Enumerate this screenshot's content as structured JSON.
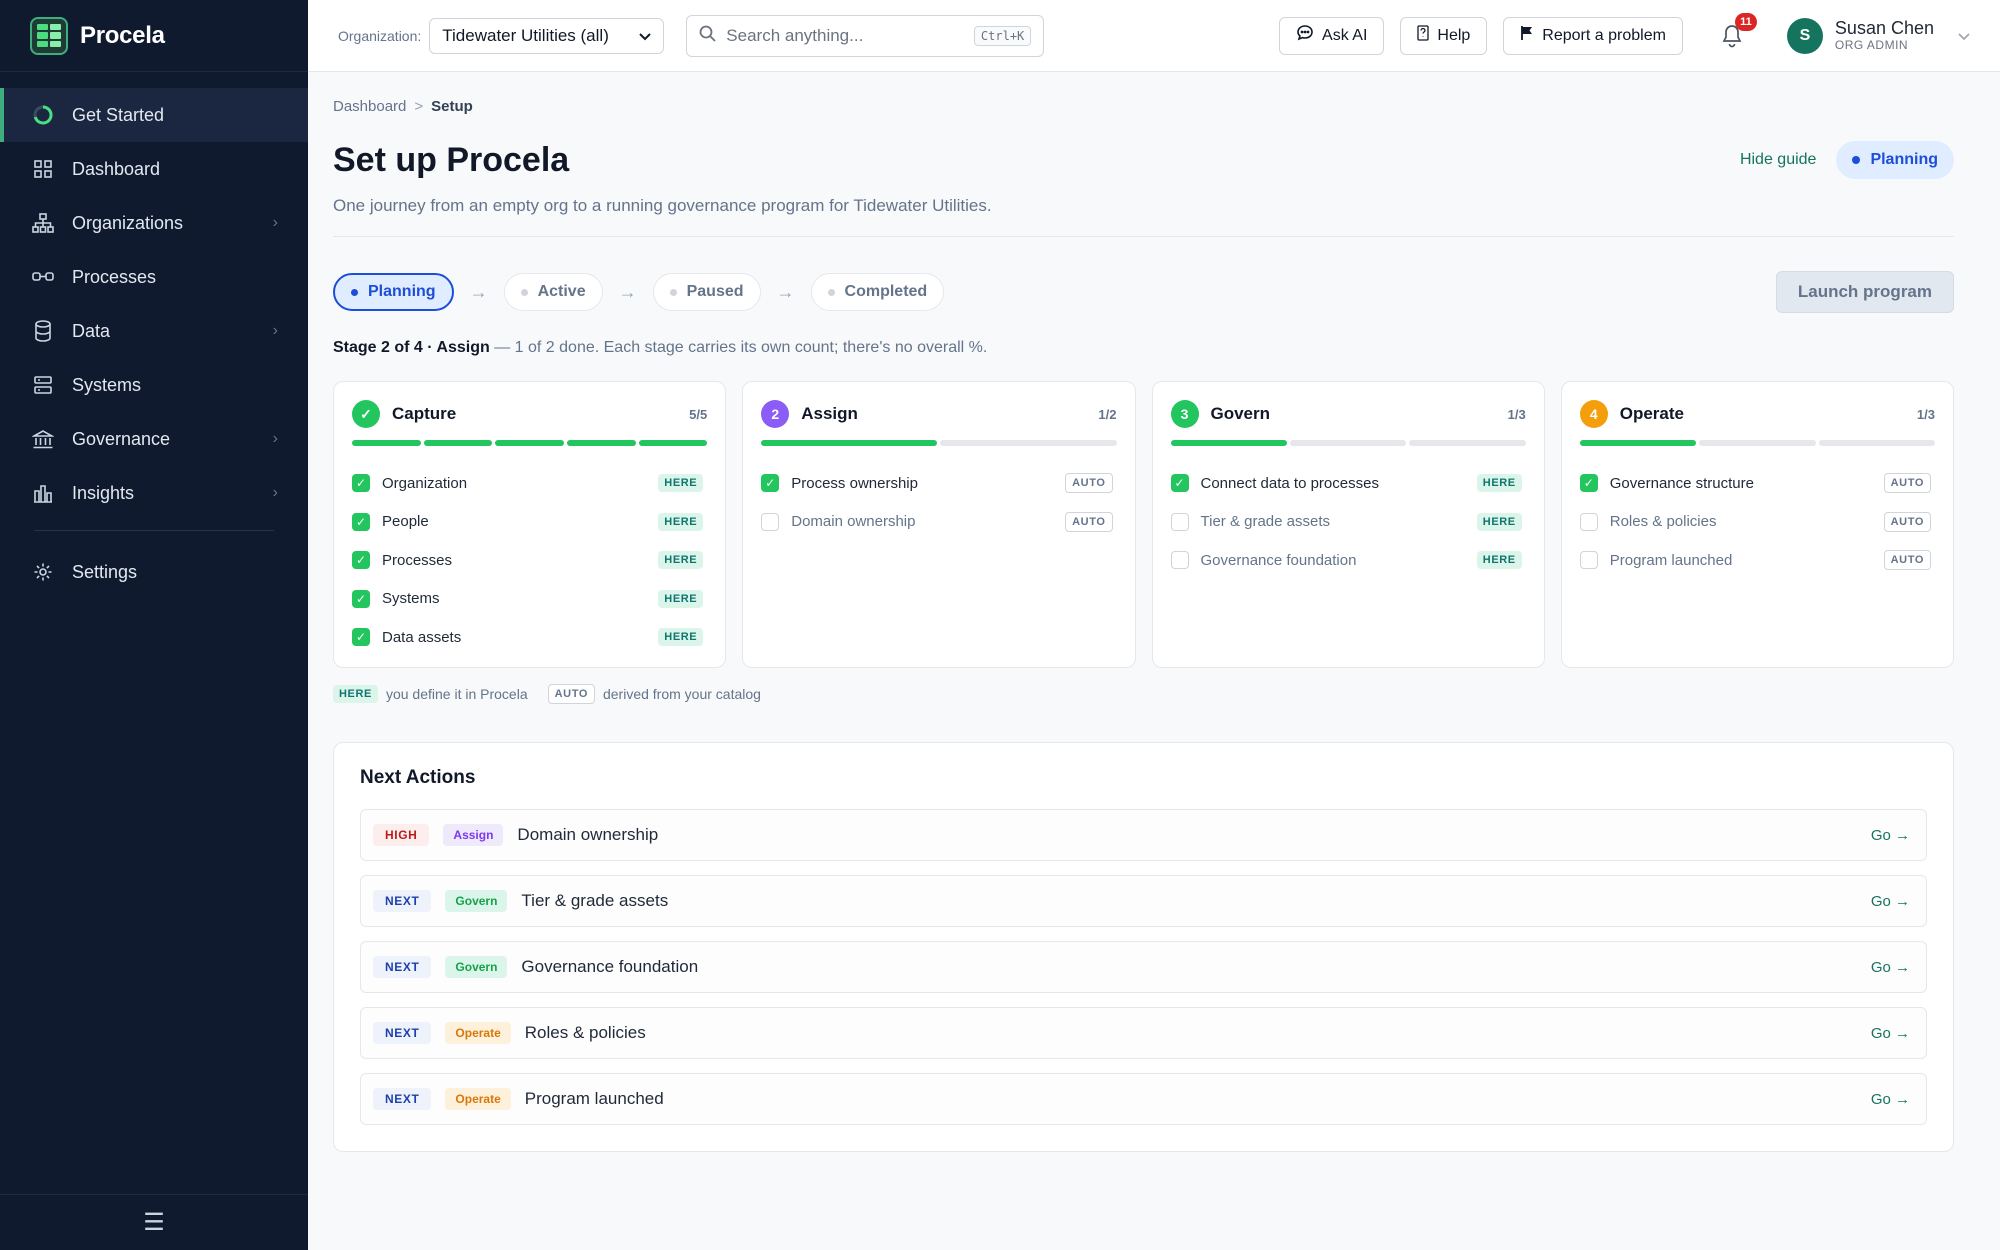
{
  "brand": {
    "name": "Procela"
  },
  "sidebar": {
    "items": [
      {
        "label": "Get Started",
        "icon": "progress-ring-icon",
        "active": true,
        "chevron": false
      },
      {
        "label": "Dashboard",
        "icon": "grid-icon",
        "chevron": false
      },
      {
        "label": "Organizations",
        "icon": "org-chart-icon",
        "chevron": true
      },
      {
        "label": "Processes",
        "icon": "process-link-icon",
        "chevron": false
      },
      {
        "label": "Data",
        "icon": "database-icon",
        "chevron": true
      },
      {
        "label": "Systems",
        "icon": "server-icon",
        "chevron": false
      },
      {
        "label": "Governance",
        "icon": "bank-icon",
        "chevron": true
      },
      {
        "label": "Insights",
        "icon": "bar-chart-icon",
        "chevron": true
      }
    ],
    "settings_label": "Settings",
    "menu_glyph": "☰",
    "chevron_glyph": "›"
  },
  "topbar": {
    "org_label": "Organization:",
    "org_value": "Tidewater Utilities (all)",
    "search_placeholder": "Search anything...",
    "search_shortcut": "Ctrl+K",
    "ask_ai": "Ask AI",
    "help": "Help",
    "report": "Report a problem",
    "notification_count": "11",
    "user_initial": "S",
    "user_name": "Susan Chen",
    "user_role": "ORG ADMIN"
  },
  "breadcrumb": {
    "root": "Dashboard",
    "sep": ">",
    "current": "Setup"
  },
  "page": {
    "title": "Set up Procela",
    "subtitle": "One journey from an empty org to a running governance program for Tidewater Utilities.",
    "hide_guide": "Hide guide",
    "status": "Planning"
  },
  "lifecycle": {
    "stages": [
      "Planning",
      "Active",
      "Paused",
      "Completed"
    ],
    "current": 0,
    "arrow": "→",
    "launch_label": "Launch program"
  },
  "stage_line": {
    "bold": "Stage 2 of 4 · Assign",
    "rest": " — 1 of 2 done. Each stage carries its own count; there's no overall %."
  },
  "cards": [
    {
      "num": "✓",
      "title": "Capture",
      "count": "5/5",
      "color": "#22c55e",
      "segments": 5,
      "done": 5,
      "items": [
        {
          "label": "Organization",
          "checked": true,
          "tag": "HERE"
        },
        {
          "label": "People",
          "checked": true,
          "tag": "HERE"
        },
        {
          "label": "Processes",
          "checked": true,
          "tag": "HERE"
        },
        {
          "label": "Systems",
          "checked": true,
          "tag": "HERE"
        },
        {
          "label": "Data assets",
          "checked": true,
          "tag": "HERE"
        }
      ]
    },
    {
      "num": "2",
      "title": "Assign",
      "count": "1/2",
      "color": "#8b5cf6",
      "segments": 2,
      "done": 1,
      "items": [
        {
          "label": "Process ownership",
          "checked": true,
          "tag": "AUTO"
        },
        {
          "label": "Domain ownership",
          "checked": false,
          "tag": "AUTO"
        }
      ]
    },
    {
      "num": "3",
      "title": "Govern",
      "count": "1/3",
      "color": "#22c55e",
      "segments": 3,
      "done": 1,
      "items": [
        {
          "label": "Connect data to processes",
          "checked": true,
          "tag": "HERE"
        },
        {
          "label": "Tier & grade assets",
          "checked": false,
          "tag": "HERE"
        },
        {
          "label": "Governance foundation",
          "checked": false,
          "tag": "HERE"
        }
      ]
    },
    {
      "num": "4",
      "title": "Operate",
      "count": "1/3",
      "color": "#f59e0b",
      "segments": 3,
      "done": 1,
      "items": [
        {
          "label": "Governance structure",
          "checked": true,
          "tag": "AUTO"
        },
        {
          "label": "Roles & policies",
          "checked": false,
          "tag": "AUTO"
        },
        {
          "label": "Program launched",
          "checked": false,
          "tag": "AUTO"
        }
      ]
    }
  ],
  "legend": {
    "here_tag": "HERE",
    "here_text": "you define it in Procela",
    "auto_tag": "AUTO",
    "auto_text": "derived from your catalog"
  },
  "next_actions": {
    "title": "Next Actions",
    "go_label": "Go →",
    "rows": [
      {
        "priority": "HIGH",
        "stage": "Assign",
        "label": "Domain ownership"
      },
      {
        "priority": "NEXT",
        "stage": "Govern",
        "label": "Tier & grade assets"
      },
      {
        "priority": "NEXT",
        "stage": "Govern",
        "label": "Governance foundation"
      },
      {
        "priority": "NEXT",
        "stage": "Operate",
        "label": "Roles & policies"
      },
      {
        "priority": "NEXT",
        "stage": "Operate",
        "label": "Program launched"
      }
    ]
  }
}
